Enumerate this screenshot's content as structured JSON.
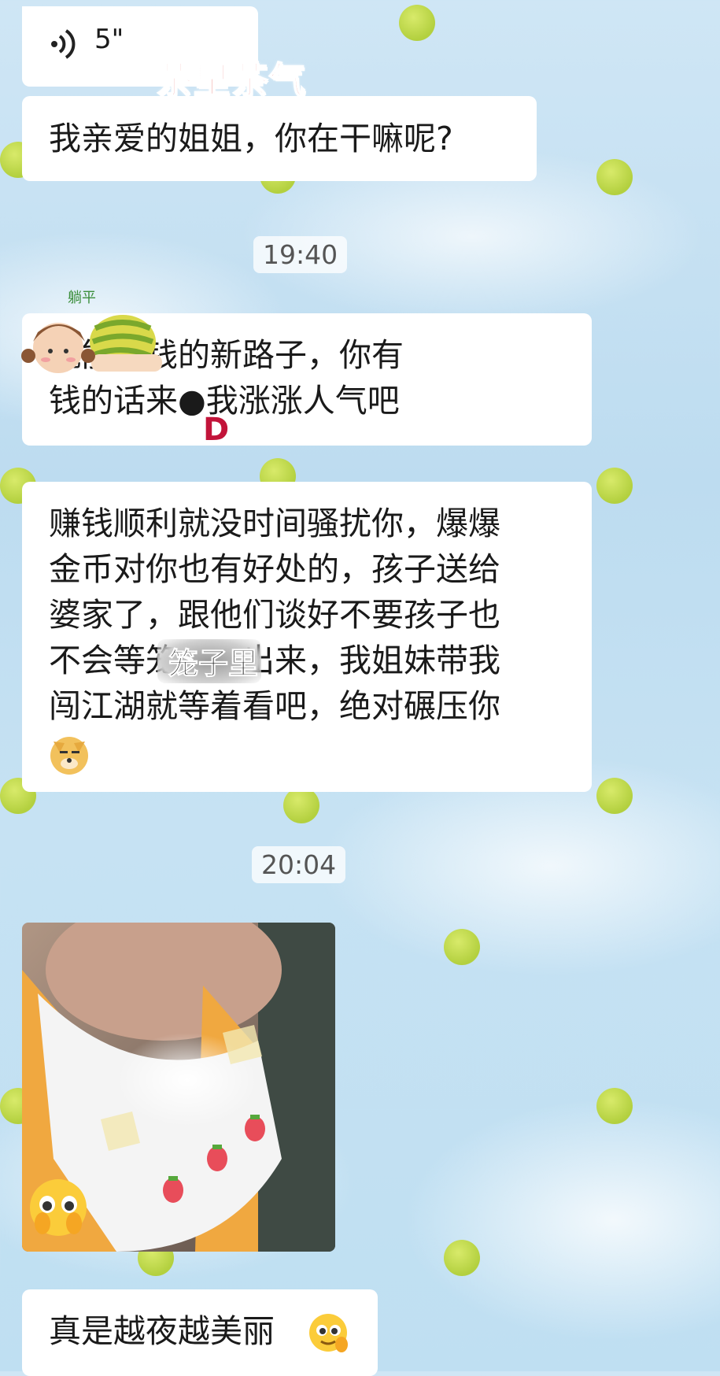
{
  "chat": {
    "voice": {
      "duration": "5\""
    },
    "sticker_title": "茶里茶气",
    "messages": {
      "m1": "我亲爱的姐姐，你在干嘛呢?",
      "ts1": "19:40",
      "m2": "就能赚钱的新路子，你有\n钱的话来●我涨涨人气吧",
      "m2_mark": "D",
      "m3": "赚钱顺利就没时间骚扰你，爆爆\n金币对你也有好处的，孩子送给\n婆家了，跟他们谈好不要孩子也\n不会等笼子里出来，我姐妹带我\n闯江湖就等着看吧，绝对碾压你",
      "m3_highlight": "笼子里",
      "ts2": "20:04",
      "m5": "真是越夜越美丽"
    }
  },
  "colors": {
    "bubble": "#ffffff",
    "dot": "#b3d03f",
    "title": "#e0342f"
  }
}
